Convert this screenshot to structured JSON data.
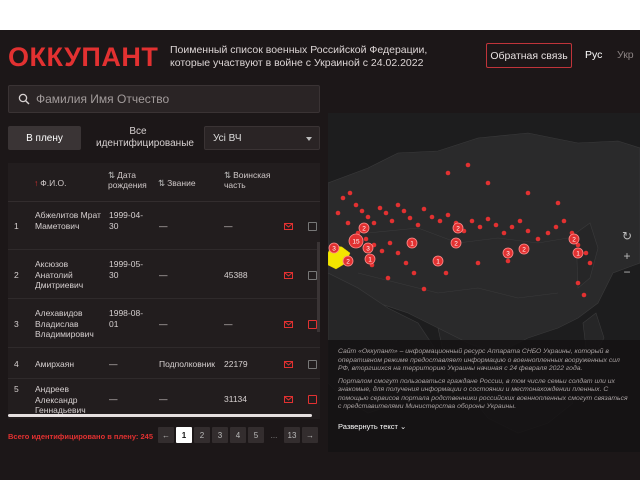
{
  "header": {
    "logo": "ОККУПАНТ",
    "subtitle": "Поименный список военных Российской Федерации, которые участвуют в войне с Украиной с 24.02.2022",
    "feedback_label": "Обратная связь",
    "lang_ru": "Рус",
    "lang_uk": "Укр"
  },
  "search": {
    "placeholder": "Фамилия Имя Отчество",
    "value": ""
  },
  "filters": {
    "tab_captive": "В плену",
    "tab_all": "Все идентифицированые",
    "unit_select": "Усі ВЧ"
  },
  "table": {
    "columns": [
      "Ф.И.О.",
      "Дата рождения",
      "Звание",
      "Воинская часть"
    ],
    "rows": [
      {
        "no": "1",
        "name": "Абжелитов Мрат Маметович",
        "dob": "1999-04-30",
        "rank": "—",
        "unit": "—"
      },
      {
        "no": "2",
        "name": "Аксюзов Анатолий Дмитриевич",
        "dob": "1999-05-30",
        "rank": "—",
        "unit": "45388"
      },
      {
        "no": "3",
        "name": "Алехавидов Владислав Владимирович",
        "dob": "1998-08-01",
        "rank": "—",
        "unit": "—"
      },
      {
        "no": "4",
        "name": "Амирхаян",
        "dob": "—",
        "rank": "Подполковник",
        "unit": "22179"
      },
      {
        "no": "5",
        "name": "Андреев Александр Геннадьевич",
        "dob": "—",
        "rank": "—",
        "unit": "31134"
      }
    ]
  },
  "footer": {
    "count_text": "Всего идентифицировано в плену: 245",
    "pages": [
      "←",
      "1",
      "2",
      "3",
      "4",
      "5",
      "...",
      "13",
      "→"
    ]
  },
  "map": {
    "clusters": [
      {
        "label": "2"
      },
      {
        "label": "15"
      },
      {
        "label": "3"
      },
      {
        "label": "1"
      },
      {
        "label": "2"
      },
      {
        "label": "2"
      },
      {
        "label": "3"
      },
      {
        "label": "2"
      },
      {
        "label": "2"
      },
      {
        "label": "1"
      },
      {
        "label": "3"
      },
      {
        "label": "2"
      },
      {
        "label": "1"
      },
      {
        "label": "1"
      }
    ],
    "accent": "#e23131",
    "ukraine_color": "#f3e600"
  },
  "info": {
    "para1": "Сайт «Оккупант» – информационный ресурс Аппарата СНБО Украины, который в оперативном режиме предоставляет информацию о военнопленных вооруженных сил РФ, вторгшихся на территорию Украины начиная с 24 февраля 2022 года.",
    "para2": "Порталом смогут пользоваться граждане России, в том числе семьи солдат или их знакомые, для получения информации о состоянии и местонахождении пленных. С помощью сервисов портала родственники российских военнопленных смогут связаться с представителями Министерства обороны Украины.",
    "expand_label": "Развернуть текст"
  }
}
